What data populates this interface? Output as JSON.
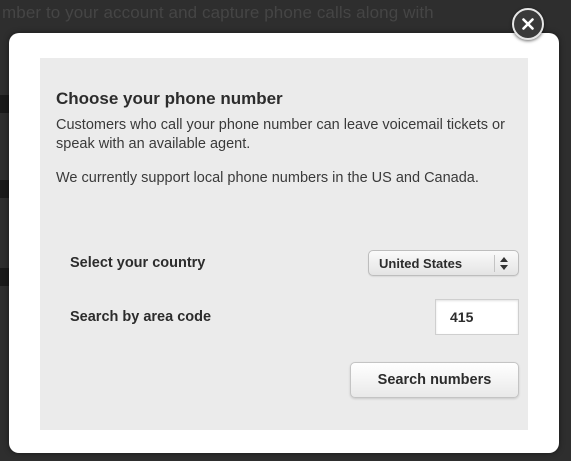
{
  "background": {
    "text": "mber to your account and capture phone calls along with"
  },
  "dialog": {
    "title": "Choose your phone number",
    "paragraphs": [
      "Customers who call your phone number can leave voicemail tickets or speak with an available agent.",
      "We currently support local phone numbers in the US and Canada."
    ],
    "country": {
      "label": "Select your country",
      "selected": "United States"
    },
    "area_code": {
      "label": "Search by area code",
      "value": "415"
    },
    "search_button": "Search numbers",
    "close_icon": "close-x-icon"
  },
  "colors": {
    "overlay": "#2e2e2e",
    "panel": "#ebebeb",
    "dialog": "#ffffff",
    "text": "#2c2c2c"
  }
}
